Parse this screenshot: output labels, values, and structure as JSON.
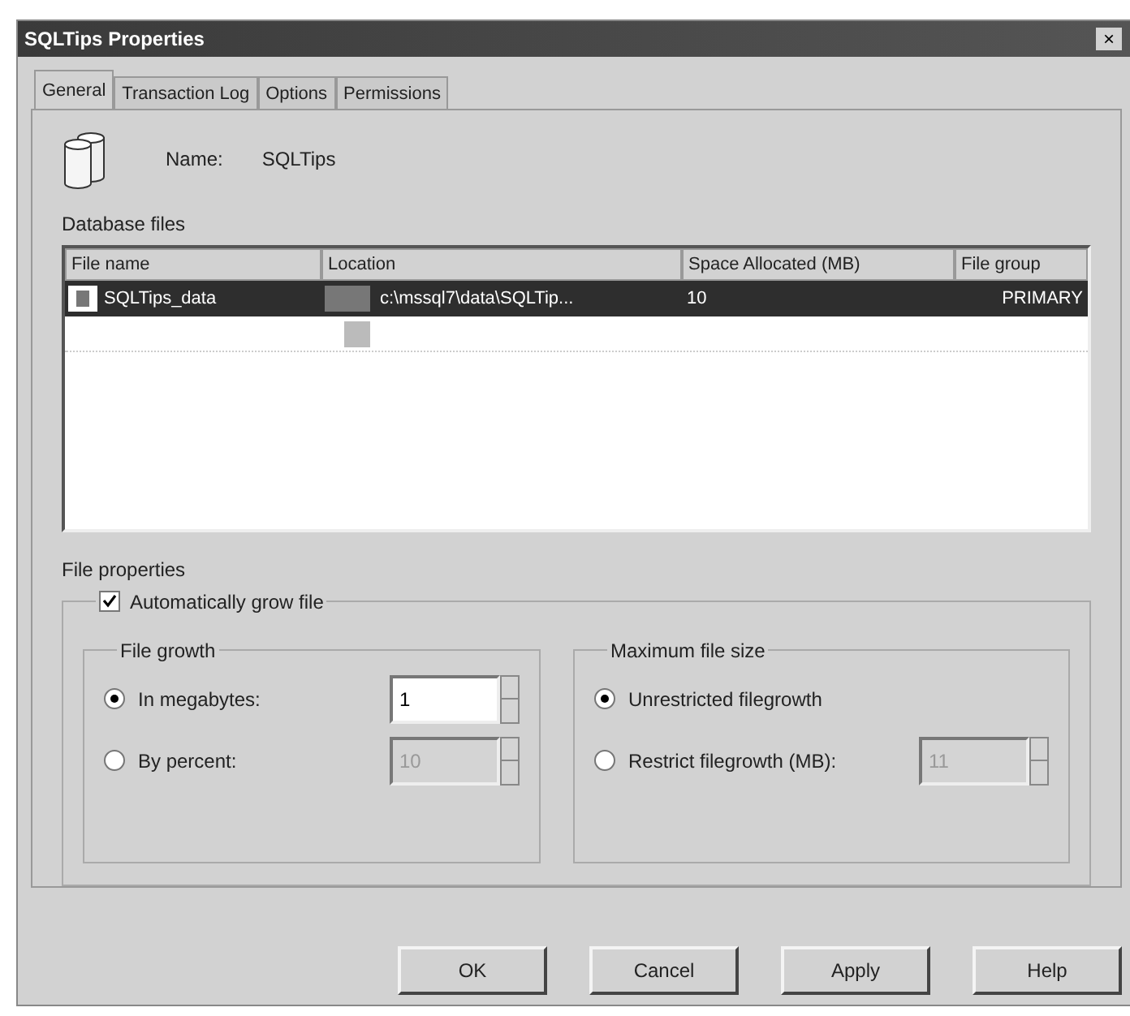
{
  "window": {
    "title": "SQLTips Properties",
    "close": "×"
  },
  "tabs": [
    {
      "label": "General",
      "selected": true
    },
    {
      "label": "Transaction Log",
      "selected": false
    },
    {
      "label": "Options",
      "selected": false
    },
    {
      "label": "Permissions",
      "selected": false
    }
  ],
  "name": {
    "label": "Name:",
    "value": "SQLTips"
  },
  "database_files": {
    "label": "Database files",
    "columns": [
      "File name",
      "Location",
      "Space Allocated (MB)",
      "File group"
    ],
    "rows": [
      {
        "file_name": "SQLTips_data",
        "location": "c:\\mssql7\\data\\SQLTip...",
        "space": "10",
        "file_group": "PRIMARY",
        "selected": true
      }
    ]
  },
  "file_properties": {
    "label": "File properties",
    "auto_grow": {
      "label": "Automatically grow file",
      "checked": true
    },
    "file_growth": {
      "label": "File growth",
      "options": [
        {
          "label": "In megabytes:",
          "selected": true,
          "value": "1",
          "disabled": false
        },
        {
          "label": "By percent:",
          "selected": false,
          "value": "10",
          "disabled": true
        }
      ]
    },
    "max_size": {
      "label": "Maximum file size",
      "options": [
        {
          "label": "Unrestricted filegrowth",
          "selected": true
        },
        {
          "label": "Restrict filegrowth (MB):",
          "selected": false,
          "value": "11",
          "disabled": true
        }
      ]
    }
  },
  "buttons": [
    "OK",
    "Cancel",
    "Apply",
    "Help"
  ]
}
